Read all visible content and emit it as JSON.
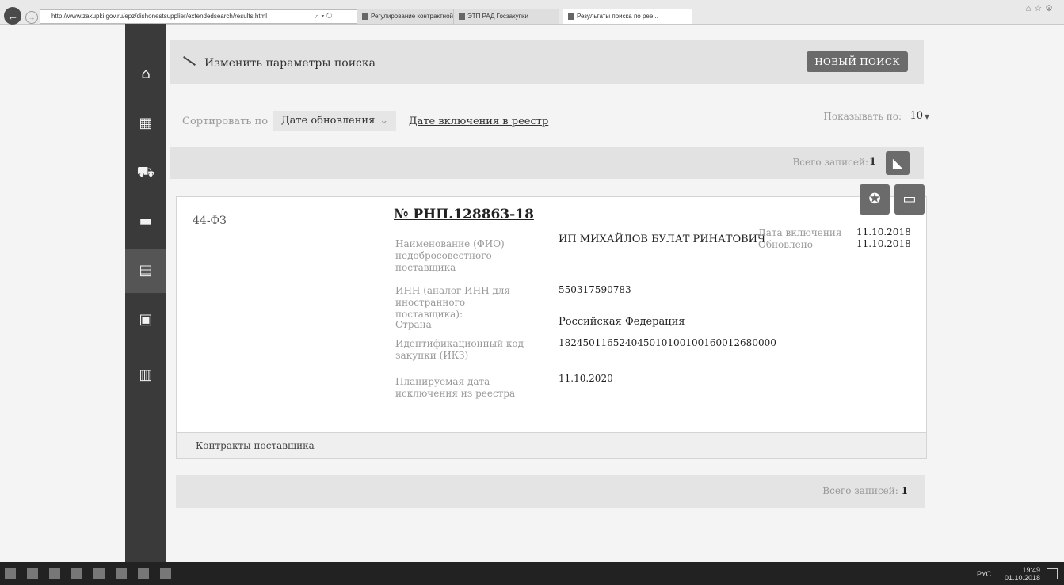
{
  "browser": {
    "address": "http://www.zakupki.gov.ru/epz/dishonestsupplier/extendedsearch/results.html",
    "tabs": [
      {
        "label": "Регулирование контрактной с..."
      },
      {
        "label": "ЭТП РАД Госзакупки"
      },
      {
        "label": "Результаты поиска по рее...",
        "active": true
      }
    ]
  },
  "sidebar": {
    "items": [
      {
        "icon": "home-icon"
      },
      {
        "icon": "calendar-icon"
      },
      {
        "icon": "cart-icon"
      },
      {
        "icon": "book-icon"
      },
      {
        "icon": "chart-document-icon",
        "active": true
      },
      {
        "icon": "briefcase-icon"
      },
      {
        "icon": "document-icon"
      }
    ]
  },
  "search": {
    "change_params_label": "Изменить параметры поиска",
    "new_search_label": "НОВЫЙ ПОИСК"
  },
  "sort": {
    "label": "Сортировать по",
    "option_update": "Дате обновления",
    "option_registry": "Дате включения в реестр"
  },
  "paging": {
    "show_label": "Показывать по:",
    "page_size": "10"
  },
  "records": {
    "label": "Всего записей:",
    "count": "1"
  },
  "record": {
    "law": "44-ФЗ",
    "number": "№ РНП.128863-18",
    "fields": [
      {
        "label": "Наименование (ФИО) недобросовестного поставщика",
        "value": "ИП МИХАЙЛОВ БУЛАТ РИНАТОВИЧ"
      },
      {
        "label": "ИНН (аналог ИНН для иностранного поставщика):",
        "value": "550317590783"
      },
      {
        "label": "Страна",
        "value": "Российская Федерация"
      },
      {
        "label": "Идентификационный код закупки (ИКЗ)",
        "value": "182450116524045010100100160012680000"
      },
      {
        "label": "Планируемая дата исключения из реестра",
        "value": "11.10.2020"
      }
    ],
    "dates": {
      "included_label": "Дата включения",
      "included_value": "11.10.2018",
      "updated_label": "Обновлено",
      "updated_value": "11.10.2018"
    },
    "contracts_link": "Контракты поставщика"
  },
  "total": {
    "label": "Всего записей:",
    "count": "1"
  },
  "taskbar": {
    "language": "РУС",
    "time": "19:49",
    "date": "01.10.2018"
  }
}
